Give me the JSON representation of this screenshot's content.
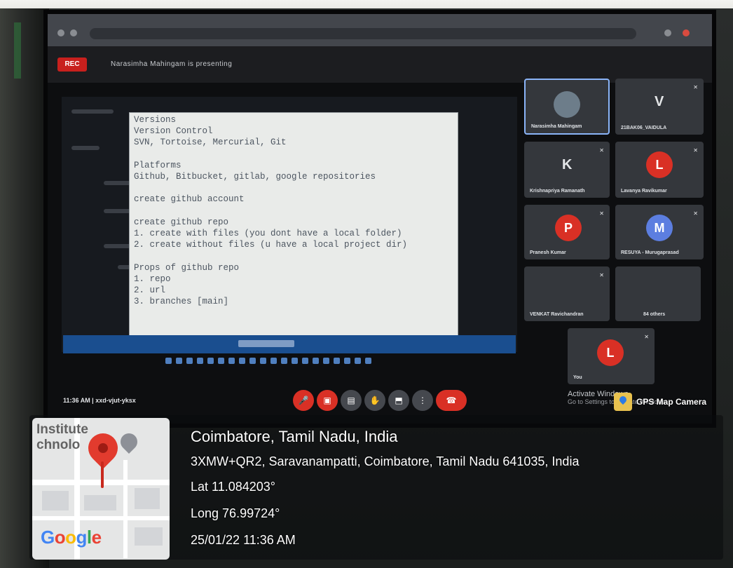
{
  "meeting": {
    "rec_label": "REC",
    "title": "Narasimha Mahingam is presenting",
    "time_label": "11:36 AM | xxd-vjut-yksx"
  },
  "notepad_text": "Versions\nVersion Control\nSVN, Tortoise, Mercurial, Git\n\nPlatforms\nGithub, Bitbucket, gitlab, google repositories\n\ncreate github account\n\ncreate github repo\n1. create with files (you dont have a local folder)\n2. create without files (u have a local project dir)\n\nProps of github repo\n1. repo\n2. url\n3. branches [main]",
  "participants": [
    {
      "name": "Narasimha Mahingam",
      "initial": "",
      "avatar_color": "",
      "kind": "photo",
      "active": true
    },
    {
      "name": "21BAK06_VAIDULA",
      "initial": "V",
      "avatar_color": "",
      "kind": "letter",
      "active": false
    },
    {
      "name": "Krishnapriya Ramanath",
      "initial": "K",
      "avatar_color": "",
      "kind": "letter",
      "active": false
    },
    {
      "name": "Lavanya Ravikumar",
      "initial": "L",
      "avatar_color": "#d93025",
      "kind": "avatar",
      "active": false
    },
    {
      "name": "Pranesh Kumar",
      "initial": "P",
      "avatar_color": "#d93025",
      "kind": "avatar",
      "active": false
    },
    {
      "name": "RESUYA - Murugaprasad",
      "initial": "M",
      "avatar_color": "#5c7ee0",
      "kind": "avatar",
      "active": false
    },
    {
      "name": "VENKAT Ravichandran",
      "initial": "",
      "avatar_color": "#7d8b7a",
      "kind": "photo",
      "active": false
    },
    {
      "name": "84 others",
      "initial": "",
      "avatar_color": "#6c6f74",
      "kind": "group",
      "active": false
    },
    {
      "name": "You",
      "initial": "L",
      "avatar_color": "#d93025",
      "kind": "avatar",
      "active": false
    }
  ],
  "windows_notice": {
    "title": "Activate Windows",
    "subtitle": "Go to Settings to activate Windows."
  },
  "gps": {
    "app_name": "GPS Map Camera",
    "map_place_text": "Institute\nchnolo",
    "google_logo": "Google",
    "city": "Coimbatore, Tamil Nadu, India",
    "address": "3XMW+QR2, Saravanampatti, Coimbatore, Tamil Nadu 641035, India",
    "lat": "Lat 11.084203°",
    "long": "Long 76.99724°",
    "datetime": "25/01/22 11:36 AM"
  },
  "colors": {
    "meet_tile": "#34373c",
    "hangup_red": "#d93025",
    "notepad_bg": "#e9ebe9",
    "taskbar_blue": "#1a4e8f"
  }
}
